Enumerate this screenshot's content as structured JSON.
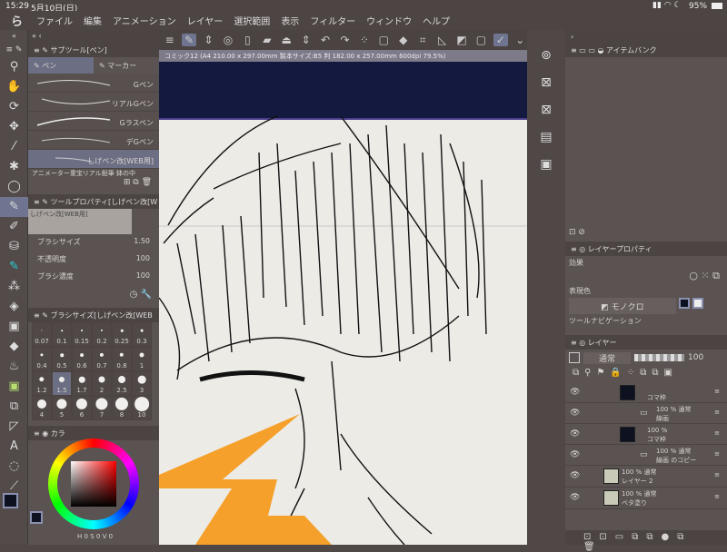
{
  "status": {
    "time": "15:29",
    "date": "5月10日(日)",
    "battery": "95%"
  },
  "menu": [
    "ファイル",
    "編集",
    "アニメーション",
    "レイヤー",
    "選択範囲",
    "表示",
    "フィルター",
    "ウィンドウ",
    "ヘルプ"
  ],
  "document_tab": "コミック12 (A4 210.00 x 297.00mm 製本サイズ:B5 判 182.00 x 257.00mm 600dpi 79.5%)",
  "subtool": {
    "title": "サブツール[ペン]",
    "tabs": [
      "ペン",
      "マーカー"
    ],
    "brushes": [
      "Gペン",
      "リアルGペン",
      "Gラスペン",
      "デGペン",
      "しげペン改[WEB用]",
      "アニメーター重宝リアル鉛筆 鉢の中"
    ],
    "selected": 4
  },
  "tool_property": {
    "title": "ツールプロパティ[しげペン改[W",
    "preset": "しげペン改[WEB用]",
    "rows": [
      {
        "label": "ブラシサイズ",
        "value": "1.50"
      },
      {
        "label": "不透明度",
        "value": "100"
      },
      {
        "label": "ブラシ濃度",
        "value": "100"
      }
    ]
  },
  "brush_size": {
    "title": "ブラシサイズ[しげペン改[WEB",
    "sizes": [
      "0.07",
      "0.1",
      "0.15",
      "0.2",
      "0.25",
      "0.3",
      "0.4",
      "0.5",
      "0.6",
      "0.7",
      "0.8",
      "1",
      "1.2",
      "1.5",
      "1.7",
      "2",
      "2.5",
      "3",
      "4",
      "5",
      "6",
      "7",
      "8",
      "10"
    ],
    "selected": "1.5"
  },
  "color": {
    "tab": "カラ",
    "hsv": [
      "0",
      "0",
      "0"
    ],
    "main": "#0e1220",
    "sub": "#3a1f33"
  },
  "item_bank": {
    "title": "アイテムバンク"
  },
  "layer_property": {
    "title": "レイヤープロパティ",
    "effect": "効果",
    "expression_color": "表現色",
    "expression_value": "モノクロ",
    "tool_nav": "ツールナビゲーション"
  },
  "layers": {
    "title": "レイヤー",
    "blend": "通常",
    "opacity": "100",
    "items": [
      {
        "line1": "",
        "line2": "コマ枠",
        "type": "frame"
      },
      {
        "line1": "100 % 通常",
        "line2": "線画",
        "type": "folder"
      },
      {
        "line1": "100 %",
        "line2": "コマ枠",
        "type": "frame"
      },
      {
        "line1": "100 % 通常",
        "line2": "線画 のコピー",
        "type": "folder"
      },
      {
        "line1": "100 % 通常",
        "line2": "レイヤー 2",
        "type": "raster"
      },
      {
        "line1": "100 % 通常",
        "line2": "ベタ塗り",
        "type": "fill"
      }
    ]
  },
  "colors": {
    "accent": "#6f7590",
    "canvas_band": "#141a3f",
    "paper": "#ecebe6",
    "annotation": "#f5a02a"
  }
}
